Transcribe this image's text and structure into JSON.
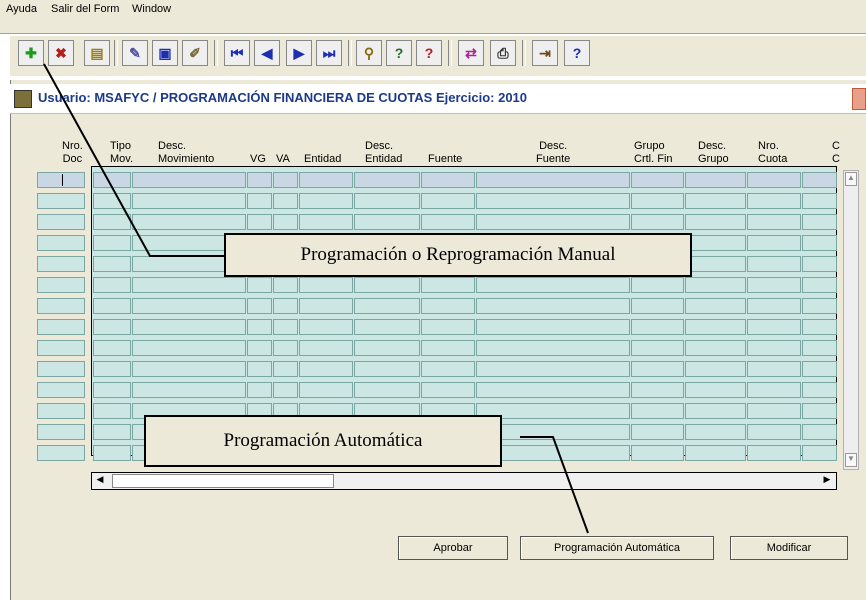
{
  "menu": {
    "items": [
      "Ayuda",
      "Salir del Form",
      "Window"
    ]
  },
  "toolbar": {
    "icons": [
      "add-icon",
      "delete-icon",
      "document-icon",
      "edit-icon",
      "save-icon",
      "clear-icon",
      "first-record-icon",
      "previous-record-icon",
      "next-record-icon",
      "last-record-icon",
      "query-icon",
      "enter-query-icon",
      "cancel-query-icon",
      "link-icon",
      "print-icon",
      "exit-icon",
      "help-icon"
    ],
    "help_label": "?"
  },
  "form": {
    "title": "Usuario: MSAFYC   /   PROGRAMACIÓN FINANCIERA DE CUOTAS  Ejercicio: 2010"
  },
  "table": {
    "doc_header": [
      "Nro.",
      "Doc"
    ],
    "headers": [
      [
        "Tipo",
        "Mov."
      ],
      [
        "Desc.",
        "Movimiento"
      ],
      [
        "",
        "VG"
      ],
      [
        "",
        "VA"
      ],
      [
        "",
        "Entidad"
      ],
      [
        "Desc.",
        "Entidad"
      ],
      [
        "",
        "Fuente"
      ],
      [
        "Desc.",
        "Fuente"
      ],
      [
        "Grupo",
        "Crtl. Fin"
      ],
      [
        "Desc.",
        "Grupo"
      ],
      [
        "Nro.",
        "Cuota"
      ],
      [
        "C",
        "C"
      ]
    ],
    "row_count": 14
  },
  "callouts": {
    "manual": "Programación o Reprogramación Manual",
    "automatic": "Programación Automática"
  },
  "buttons": {
    "approve": "Aprobar",
    "auto": "Programación Automática",
    "modify": "Modificar"
  },
  "colors": {
    "cell": "#cce7e3",
    "cell_selected": "#c9d7e5",
    "title": "#1c3a8a",
    "background": "#ece9d8"
  }
}
